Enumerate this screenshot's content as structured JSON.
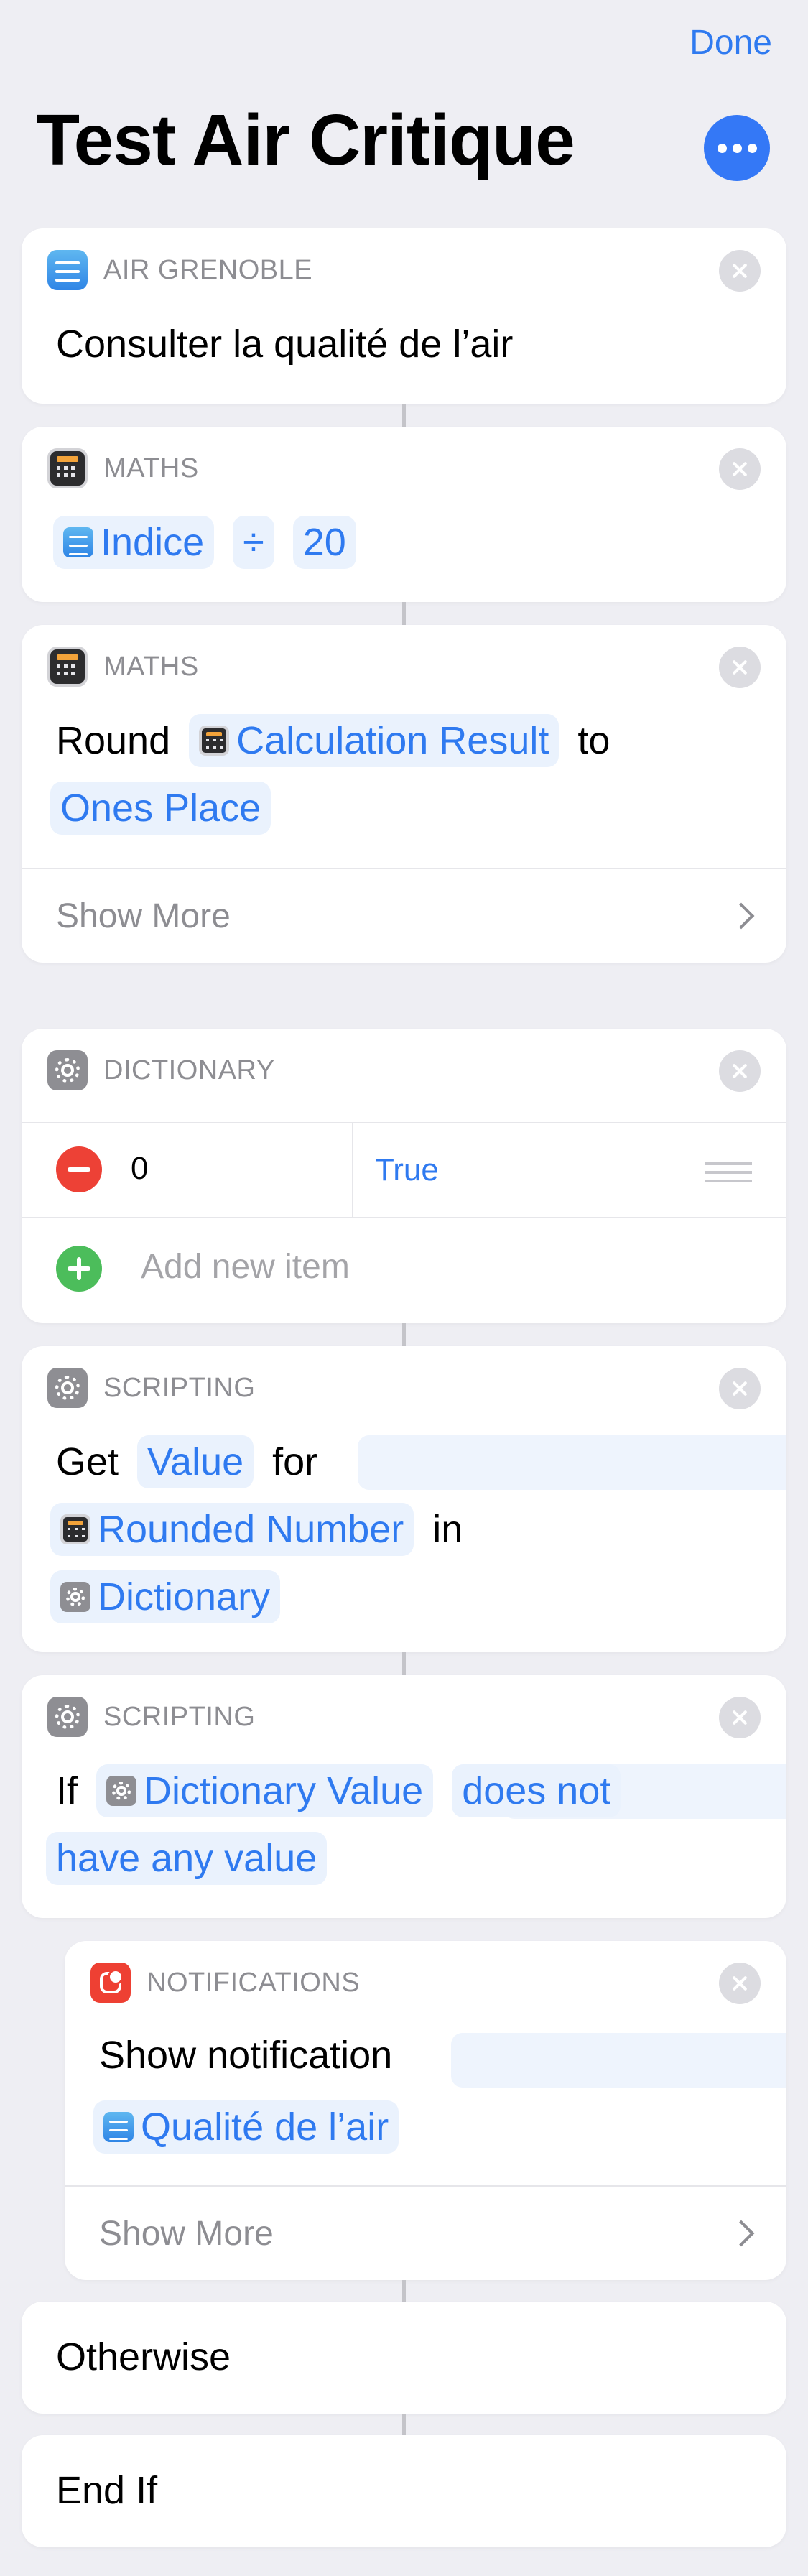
{
  "header": {
    "done_label": "Done",
    "title": "Test Air Critique",
    "more_icon": "ellipsis-icon"
  },
  "actions": {
    "air": {
      "category": "AIR GRENOBLE",
      "text": "Consulter la qualité de l’air"
    },
    "maths1": {
      "category": "MATHS",
      "operand1": "Indice",
      "operator": "÷",
      "operand2": "20"
    },
    "maths2": {
      "category": "MATHS",
      "word1": "Round",
      "variable": "Calculation Result",
      "word2": "to",
      "option": "Ones Place",
      "show_more": "Show More"
    },
    "dictionary": {
      "category": "DICTIONARY",
      "key": "0",
      "value": "True",
      "add_item": "Add new item"
    },
    "get_value": {
      "category": "SCRIPTING",
      "word1": "Get",
      "token1": "Value",
      "word2": "for",
      "variable": "Rounded Number",
      "word3": "in",
      "source": "Dictionary"
    },
    "if_action": {
      "category": "SCRIPTING",
      "word1": "If",
      "variable": "Dictionary Value",
      "condition_line1": "does not",
      "condition_line2": "have any value"
    },
    "notification": {
      "category": "NOTIFICATIONS",
      "text": "Show notification",
      "variable": "Qualité de l’air",
      "show_more": "Show More"
    },
    "otherwise": {
      "label": "Otherwise"
    },
    "endif": {
      "label": "End If"
    }
  }
}
